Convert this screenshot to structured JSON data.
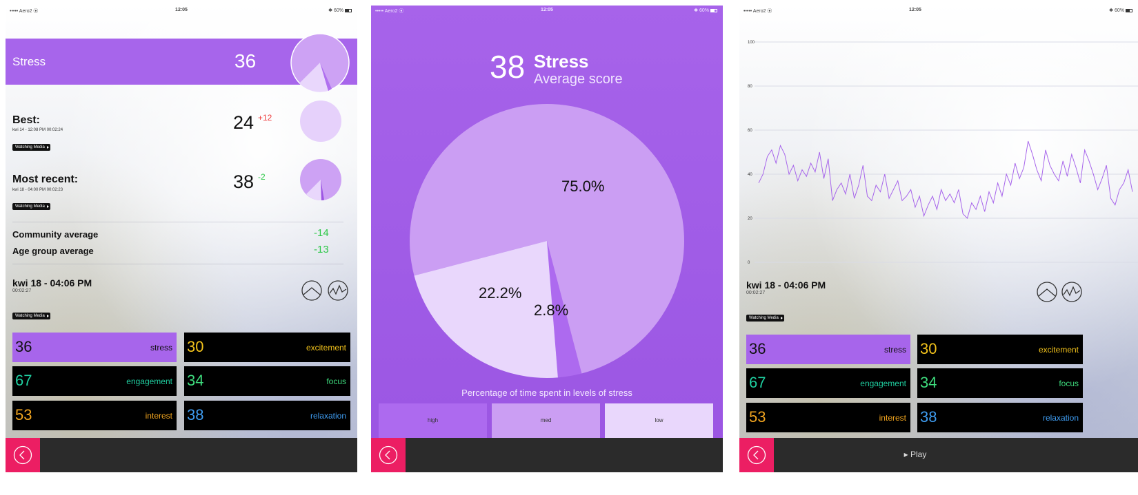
{
  "status": {
    "carrier": "••••• Aero2 ⦿",
    "time": "12:05",
    "battery": "✱ 60%"
  },
  "colors": {
    "stress": "#a765eb",
    "high": "#ad6aef",
    "med": "#cb9ef3",
    "low": "#e9d7fc",
    "back": "#ec1e63"
  },
  "screen1": {
    "stress_label": "Stress",
    "stress_value": "36",
    "best": {
      "title": "Best:",
      "sub": "kwi 14 - 12:08 PM 00:02:24",
      "tag": "Watching Media",
      "value": "24",
      "delta": "+12"
    },
    "recent": {
      "title": "Most recent:",
      "sub": "kwi 18 - 04:00 PM 00:02:23",
      "tag": "Watching Media",
      "value": "38",
      "delta": "-2"
    },
    "community": {
      "label": "Community average",
      "value": "-14"
    },
    "agegroup": {
      "label": "Age group average",
      "value": "-13"
    }
  },
  "session": {
    "title": "kwi 18 - 04:06 PM",
    "duration": "00:02:27",
    "tag": "Watching Media"
  },
  "metrics": [
    {
      "value": "36",
      "name": "stress",
      "color": "#a765eb"
    },
    {
      "value": "30",
      "name": "excitement",
      "color": "#f2c21b"
    },
    {
      "value": "67",
      "name": "engagement",
      "color": "#1fcfa0"
    },
    {
      "value": "34",
      "name": "focus",
      "color": "#3edc7d"
    },
    {
      "value": "53",
      "name": "interest",
      "color": "#f2a51f"
    },
    {
      "value": "38",
      "name": "relaxation",
      "color": "#3f9df2"
    }
  ],
  "screen2": {
    "avg_value": "38",
    "avg_title": "Stress",
    "avg_sub": "Average score",
    "caption": "Percentage of time spent in levels of stress",
    "legend": [
      "high",
      "med",
      "low"
    ]
  },
  "chart_data": [
    {
      "type": "pie",
      "labels": [
        "high",
        "med",
        "low"
      ],
      "values": [
        2.8,
        75.0,
        22.2
      ],
      "data_labels": [
        "2.8%",
        "75.0%",
        "22.2%"
      ]
    },
    {
      "type": "line",
      "ylim": [
        0,
        100
      ],
      "yticks": [
        0,
        20,
        40,
        60,
        80,
        100
      ],
      "series": [
        {
          "values": [
            36,
            40,
            48,
            51,
            45,
            53,
            49,
            40,
            44,
            37,
            42,
            39,
            45,
            41,
            50,
            38,
            47,
            28,
            33,
            36,
            31,
            40,
            29,
            35,
            44,
            30,
            28,
            35,
            32,
            40,
            29,
            33,
            37,
            28,
            30,
            33,
            25,
            30,
            21,
            26,
            30,
            24,
            33,
            28,
            31,
            27,
            33,
            22,
            20,
            27,
            24,
            30,
            23,
            32,
            27,
            36,
            30,
            40,
            35,
            45,
            38,
            43,
            55,
            49,
            42,
            37,
            51,
            44,
            40,
            37,
            46,
            39,
            49,
            43,
            36,
            51,
            46,
            40,
            33,
            38,
            44,
            29,
            26,
            33,
            36,
            42,
            32
          ]
        }
      ]
    }
  ],
  "play_label": "▸ Play"
}
